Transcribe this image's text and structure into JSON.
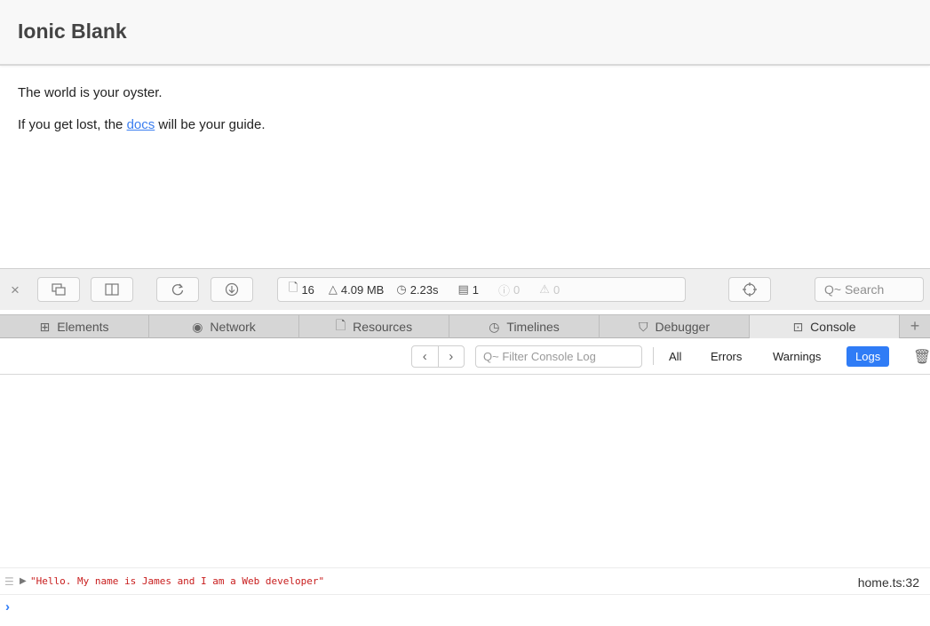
{
  "app": {
    "title": "Ionic Blank",
    "line1": "The world is your oyster.",
    "line2_before": "If you get lost, the ",
    "line2_link": "docs",
    "line2_after": " will be your guide."
  },
  "devtools": {
    "toolbar": {
      "close": "×",
      "resources_count": "16",
      "memory": "4.09 MB",
      "load_time": "2.23s",
      "log_count": "1",
      "error_count": "0",
      "warning_count": "0",
      "search_placeholder": "Q~ Search"
    },
    "tabs": [
      {
        "label": "Elements",
        "icon": "elements-icon"
      },
      {
        "label": "Network",
        "icon": "network-icon"
      },
      {
        "label": "Resources",
        "icon": "resources-icon"
      },
      {
        "label": "Timelines",
        "icon": "timelines-icon"
      },
      {
        "label": "Debugger",
        "icon": "debugger-icon"
      },
      {
        "label": "Console",
        "icon": "console-icon"
      }
    ],
    "filter": {
      "placeholder": "Q~ Filter Console Log",
      "options": [
        "All",
        "Errors",
        "Warnings",
        "Logs"
      ],
      "selected": "Logs"
    },
    "console": {
      "message": "\"Hello. My name is James and I am a Web developer\"",
      "source": "home.ts:32"
    }
  },
  "colors": {
    "accent": "#2f7cf6",
    "link": "#3b7ef0",
    "log_text": "#c81d1d"
  }
}
